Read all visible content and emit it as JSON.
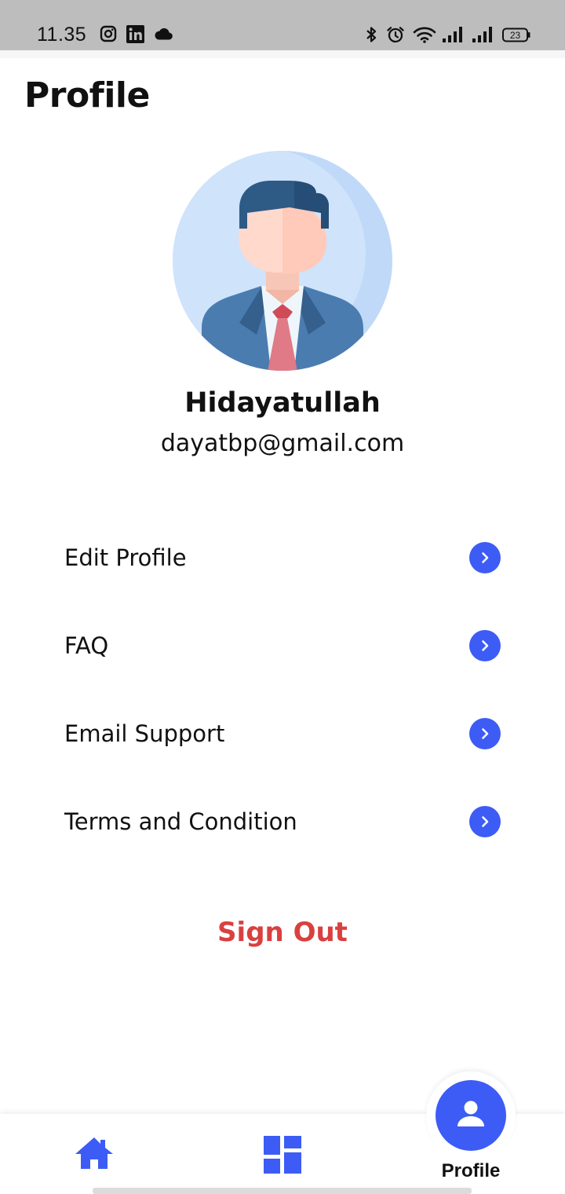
{
  "status_bar": {
    "time": "11.35",
    "battery": "23",
    "icons": [
      "instagram-icon",
      "linkedin-icon",
      "cloud-icon",
      "bluetooth-icon",
      "alarm-icon",
      "wifi-icon",
      "signal-icon",
      "signal-icon",
      "battery-icon"
    ]
  },
  "page": {
    "title": "Profile"
  },
  "user": {
    "name": "Hidayatullah",
    "email": "dayatbp@gmail.com"
  },
  "menu": {
    "items": [
      {
        "label": "Edit Profile",
        "icon": "chevron-right-icon"
      },
      {
        "label": "FAQ",
        "icon": "chevron-right-icon"
      },
      {
        "label": "Email Support",
        "icon": "chevron-right-icon"
      },
      {
        "label": "Terms and Condition",
        "icon": "chevron-right-icon"
      }
    ]
  },
  "sign_out": {
    "label": "Sign Out"
  },
  "bottom_nav": {
    "items": [
      {
        "icon": "home-icon"
      },
      {
        "icon": "dashboard-icon"
      },
      {
        "icon": "user-icon",
        "label": "Profile",
        "active": true
      }
    ]
  },
  "colors": {
    "accent": "#3d5cf5",
    "sign_out": "#d94040",
    "status_bar": "#bdbdbd"
  }
}
